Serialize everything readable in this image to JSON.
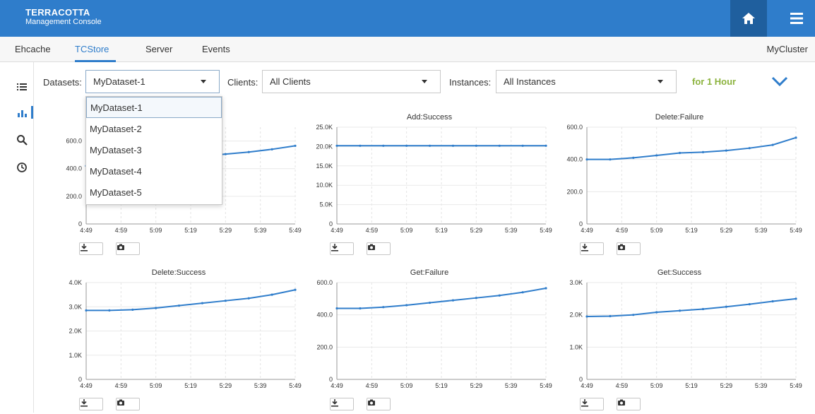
{
  "brand": {
    "line1": "TERRACOTTA",
    "line2": "Management Console"
  },
  "header": {
    "home_icon": "home-icon",
    "menu_icon": "hamburger-menu-icon",
    "accent": "#2f7dcb"
  },
  "tabs": [
    {
      "label": "Ehcache"
    },
    {
      "label": "TCStore",
      "active": true
    },
    {
      "label": "Server"
    },
    {
      "label": "Events"
    }
  ],
  "cluster_name": "MyCluster",
  "rail": [
    "list-icon",
    "bar-chart-icon",
    "search-icon",
    "clock-icon"
  ],
  "filters": {
    "datasets_label": "Datasets:",
    "datasets_value": "MyDataset-1",
    "clients_label": "Clients:",
    "clients_value": "All Clients",
    "instances_label": "Instances:",
    "instances_value": "All Instances",
    "time_range": "for 1 Hour"
  },
  "dropdown": {
    "options": [
      "MyDataset-1",
      "MyDataset-2",
      "MyDataset-3",
      "MyDataset-4",
      "MyDataset-5"
    ],
    "selected": "MyDataset-1"
  },
  "chart_data": [
    {
      "type": "line",
      "title": "",
      "x": [
        "4:49",
        "4:59",
        "5:09",
        "5:19",
        "5:29",
        "5:39",
        "5:49"
      ],
      "yticks": [
        "0",
        "200.0",
        "400.0",
        "600.0"
      ],
      "ylim": [
        0,
        700
      ],
      "values": [
        420,
        430,
        440,
        455,
        470,
        490,
        505,
        520,
        540,
        565
      ]
    },
    {
      "type": "line",
      "title": "Add:Success",
      "x": [
        "4:49",
        "4:59",
        "5:09",
        "5:19",
        "5:29",
        "5:39",
        "5:49"
      ],
      "yticks": [
        "0",
        "5.0K",
        "10.0K",
        "15.0K",
        "20.0K",
        "25.0K"
      ],
      "ylim": [
        0,
        25000
      ],
      "values": [
        20200,
        20200,
        20200,
        20200,
        20200,
        20200,
        20200,
        20200,
        20200,
        20200
      ]
    },
    {
      "type": "line",
      "title": "Delete:Failure",
      "x": [
        "4:49",
        "4:59",
        "5:09",
        "5:19",
        "5:29",
        "5:39",
        "5:49"
      ],
      "yticks": [
        "0",
        "200.0",
        "400.0",
        "600.0"
      ],
      "ylim": [
        0,
        600
      ],
      "values": [
        400,
        400,
        410,
        425,
        440,
        445,
        455,
        470,
        490,
        535
      ]
    },
    {
      "type": "line",
      "title": "Delete:Success",
      "x": [
        "4:49",
        "4:59",
        "5:09",
        "5:19",
        "5:29",
        "5:39",
        "5:49"
      ],
      "yticks": [
        "0",
        "1.0K",
        "2.0K",
        "3.0K",
        "4.0K"
      ],
      "ylim": [
        0,
        4000
      ],
      "values": [
        2850,
        2850,
        2880,
        2950,
        3050,
        3150,
        3250,
        3350,
        3500,
        3700
      ]
    },
    {
      "type": "line",
      "title": "Get:Failure",
      "x": [
        "4:49",
        "4:59",
        "5:09",
        "5:19",
        "5:29",
        "5:39",
        "5:49"
      ],
      "yticks": [
        "0",
        "200.0",
        "400.0",
        "600.0"
      ],
      "ylim": [
        0,
        600
      ],
      "values": [
        440,
        440,
        448,
        460,
        475,
        490,
        505,
        520,
        540,
        565
      ]
    },
    {
      "type": "line",
      "title": "Get:Success",
      "x": [
        "4:49",
        "4:59",
        "5:09",
        "5:19",
        "5:29",
        "5:39",
        "5:49"
      ],
      "yticks": [
        "0",
        "1.0K",
        "2.0K",
        "3.0K"
      ],
      "ylim": [
        0,
        3000
      ],
      "values": [
        1950,
        1960,
        2000,
        2080,
        2130,
        2180,
        2250,
        2330,
        2420,
        2500
      ]
    }
  ]
}
